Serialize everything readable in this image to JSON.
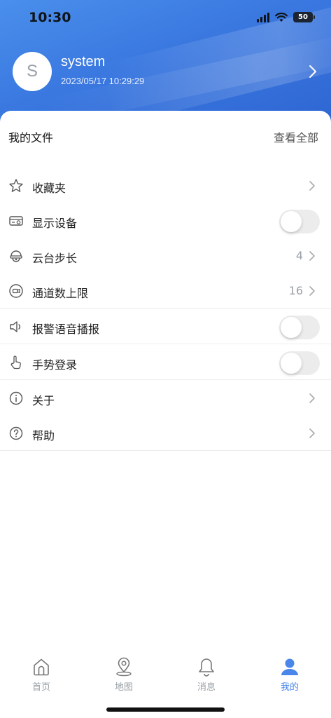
{
  "status_bar": {
    "time": "10:30",
    "battery": "50"
  },
  "profile": {
    "avatar_letter": "S",
    "username": "system",
    "login_time": "2023/05/17 10:29:29"
  },
  "files": {
    "title": "我的文件",
    "view_all": "查看全部"
  },
  "menu": {
    "favorites": {
      "label": "收藏夹",
      "icon": "star-icon"
    },
    "display_device": {
      "label": "显示设备",
      "icon": "device-card-icon",
      "toggle_on": false
    },
    "ptz_step": {
      "label": "云台步长",
      "value": "4",
      "icon": "ptz-camera-icon"
    },
    "channel_limit": {
      "label": "通道数上限",
      "value": "16",
      "icon": "channel-icon"
    },
    "alarm_voice": {
      "label": "报警语音播报",
      "icon": "speaker-icon",
      "toggle_on": false
    },
    "gesture_login": {
      "label": "手势登录",
      "icon": "hand-pointer-icon",
      "toggle_on": false
    },
    "about": {
      "label": "关于",
      "icon": "info-icon"
    },
    "help": {
      "label": "帮助",
      "icon": "help-icon"
    }
  },
  "tabbar": {
    "home": {
      "label": "首页",
      "icon": "home-icon"
    },
    "map": {
      "label": "地图",
      "icon": "map-pin-icon"
    },
    "messages": {
      "label": "消息",
      "icon": "bell-icon"
    },
    "mine": {
      "label": "我的",
      "icon": "person-icon",
      "active": true
    }
  },
  "colors": {
    "header_blue": "#3a78e0",
    "accent": "#4a86ea",
    "toggle_off": "#ececed"
  }
}
